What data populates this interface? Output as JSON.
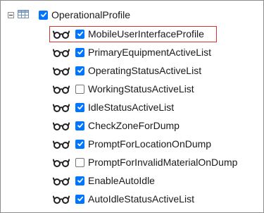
{
  "tree": {
    "root": {
      "label": "OperationalProfile",
      "checked": true,
      "icon": "table-icon",
      "expander": "collapse-minus-icon"
    },
    "children": [
      {
        "label": "MobileUserInterfaceProfile",
        "checked": true,
        "highlighted": true
      },
      {
        "label": "PrimaryEquipmentActiveList",
        "checked": true
      },
      {
        "label": "OperatingStatusActiveList",
        "checked": true
      },
      {
        "label": "WorkingStatusActiveList",
        "checked": false
      },
      {
        "label": "IdleStatusActiveList",
        "checked": true
      },
      {
        "label": "CheckZoneForDump",
        "checked": true
      },
      {
        "label": "PromptForLocationOnDump",
        "checked": true
      },
      {
        "label": "PromptForInvalidMaterialOnDump",
        "checked": false
      },
      {
        "label": "EnableAutoIdle",
        "checked": true
      },
      {
        "label": "AutoIdleStatusActiveList",
        "checked": true
      }
    ],
    "child_icon": "glasses-icon",
    "colors": {
      "checkbox_accent": "#0075ff",
      "highlight_border": "#d9342b",
      "frame_border": "#8c8c8c"
    }
  }
}
